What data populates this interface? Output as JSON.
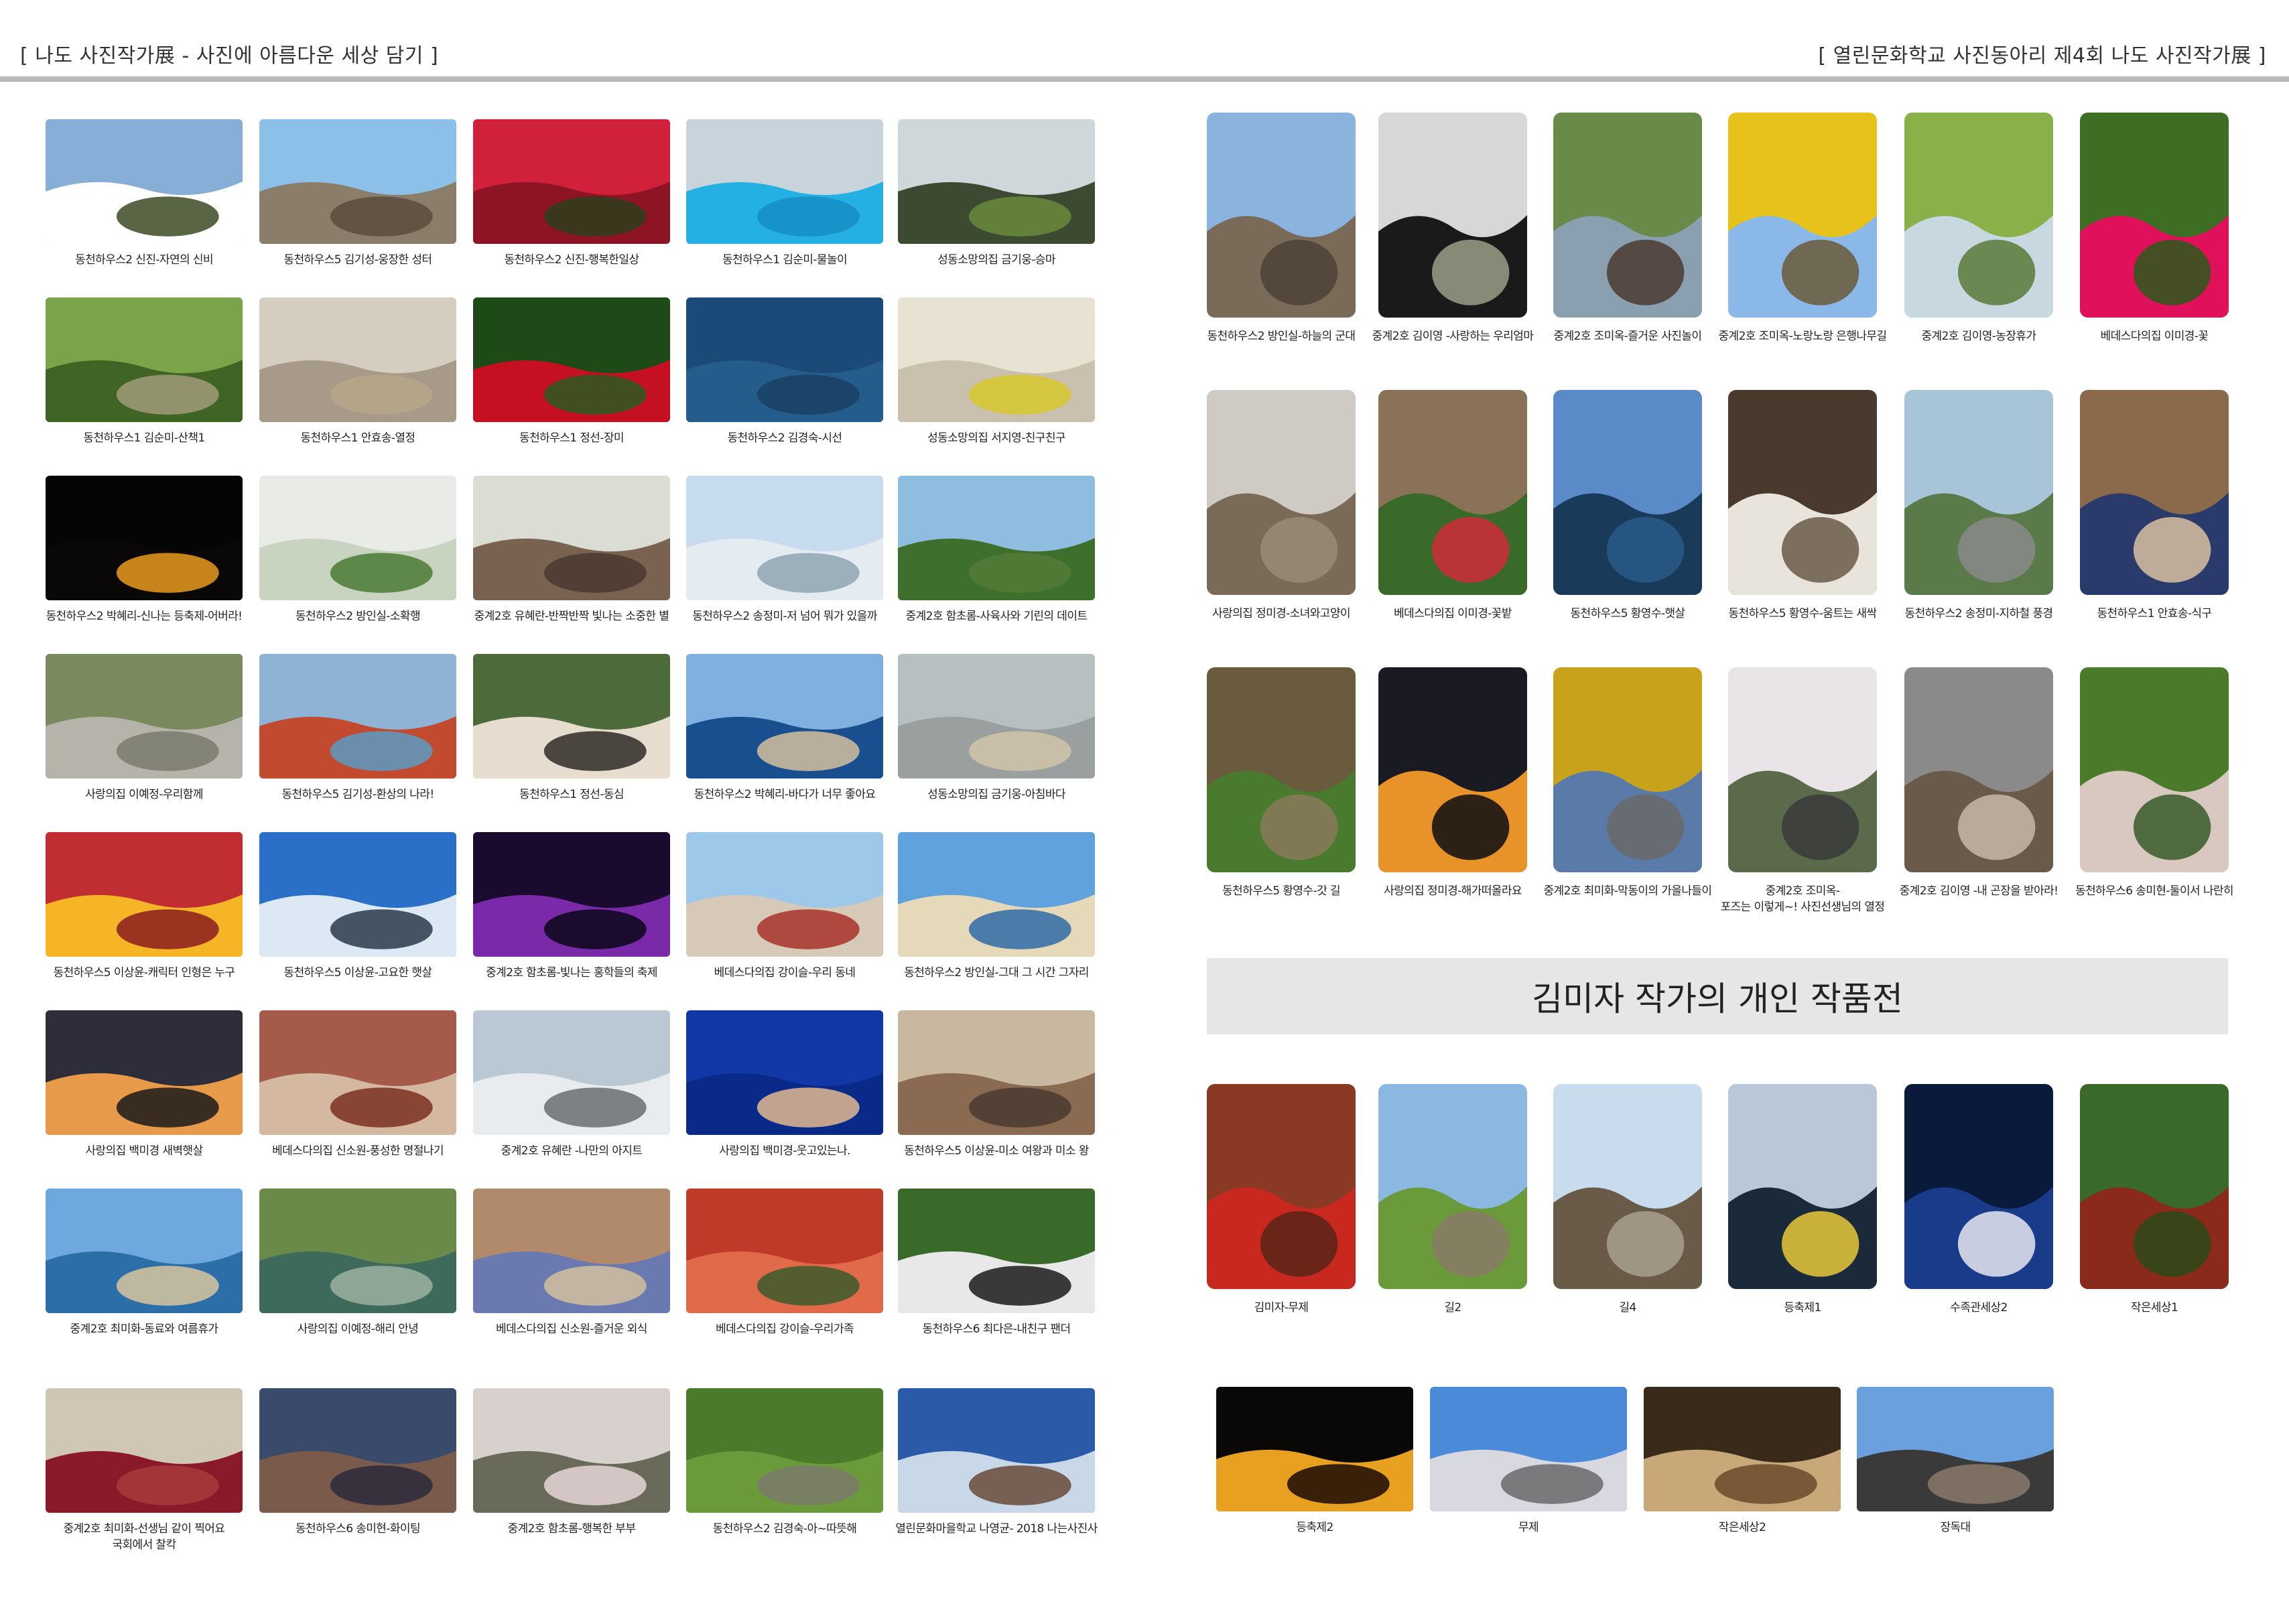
{
  "header": {
    "left_title": "[ 나도 사진작가展 - 사진에 아름다운 세상 담기 ]",
    "right_title": "[ 열린문화학교 사진동아리 제4회 나도 사진작가展 ]"
  },
  "section_banner": "김미자 작가의 개인 작품전",
  "colors": {
    "header_rule": "#b9b9b9",
    "banner_bg": "#e6e6e6"
  },
  "left_page": [
    {
      "caption": "동천하우스2 신진-자연의 신비",
      "colors": [
        "#86aed6",
        "#ffffff",
        "#3d4a26"
      ]
    },
    {
      "caption": "동천하우스5 김기성-웅장한 성터",
      "colors": [
        "#8cc0e8",
        "#8a7d6a",
        "#5b4b3c"
      ]
    },
    {
      "caption": "동천하우스2 신진-행복한일상",
      "colors": [
        "#d1203a",
        "#8c1424",
        "#2d3d1c"
      ]
    },
    {
      "caption": "동천하우스1 김순미-물놀이",
      "colors": [
        "#c8d4dc",
        "#24b0e2",
        "#168ec4"
      ]
    },
    {
      "caption": "성동소망의집 금기웅-승마",
      "colors": [
        "#cfd7db",
        "#3c4a32",
        "#6a8a3c"
      ]
    },
    {
      "caption": "동천하우스1 김순미-산책1",
      "colors": [
        "#7aa34a",
        "#3f6424",
        "#a19a7a"
      ]
    },
    {
      "caption": "동천하우스1 안효송-열정",
      "colors": [
        "#d5cdbf",
        "#a89a88",
        "#b6a78a"
      ]
    },
    {
      "caption": "동천하우스1 정선-장미",
      "colors": [
        "#1e4a18",
        "#c41020",
        "#2a5a1e"
      ]
    },
    {
      "caption": "동천하우스2 김경숙-시선",
      "colors": [
        "#1b4a78",
        "#245c8c",
        "#1a3f63"
      ]
    },
    {
      "caption": "성동소망의집 서지영-친구친구",
      "colors": [
        "#e8e2d2",
        "#c9c0ad",
        "#d8c82e"
      ]
    },
    {
      "caption": "동천하우스2 박혜리-신나는 등축제-어버라!",
      "colors": [
        "#050505",
        "#0a0806",
        "#e89a20"
      ]
    },
    {
      "caption": "동천하우스2 방인실-소확행",
      "colors": [
        "#e9ece6",
        "#c8d4c0",
        "#4a7a34"
      ]
    },
    {
      "caption": "중계2호 유혜란-반짝반짝 빛나는 소중한 별",
      "colors": [
        "#d9ddd4",
        "#7a6250",
        "#4a3a30"
      ]
    },
    {
      "caption": "동천하우스2 송정미-저 넘어 뭐가 있을까",
      "colors": [
        "#c7dcef",
        "#e5ecf1",
        "#8ea6b2"
      ]
    },
    {
      "caption": "중계2호 함초롬-사육사와 기린의 데이트",
      "colors": [
        "#8fbde0",
        "#3f6f2c",
        "#527b36"
      ]
    },
    {
      "caption": "사랑의집 이예정-우리함께",
      "colors": [
        "#7a8a5e",
        "#b5b3aa",
        "#7a7a70"
      ]
    },
    {
      "caption": "동천하우스5 김기성-환상의 나라!",
      "colors": [
        "#8fb3d4",
        "#c24a2e",
        "#5a9ac2"
      ]
    },
    {
      "caption": "동천하우스1 정선-동심",
      "colors": [
        "#4d6a3a",
        "#e7ddcf",
        "#2e2a26"
      ]
    },
    {
      "caption": "동천하우스2 박혜리-바다가 너무 좋아요",
      "colors": [
        "#7fb0e0",
        "#1a4f8f",
        "#d3c09e"
      ]
    },
    {
      "caption": "성동소망의집 금기웅-아침바다",
      "colors": [
        "#b8bfc1",
        "#9aa0a0",
        "#d1c3a8"
      ]
    },
    {
      "caption": "동천하우스5 이상윤-캐릭터 인형은 누구",
      "colors": [
        "#c02e32",
        "#f5b526",
        "#8a1c20"
      ]
    },
    {
      "caption": "동천하우스5 이상윤-고요한 햇살",
      "colors": [
        "#2a6fc8",
        "#dce8f4",
        "#2a3a4a"
      ]
    },
    {
      "caption": "중계2호 함초롬-빛나는 홍학들의 축제",
      "colors": [
        "#1a0a2e",
        "#7a2aa8",
        "#0b061a"
      ]
    },
    {
      "caption": "베데스다의집 강이슬-우리 동네",
      "colors": [
        "#9ec8ea",
        "#d7c9b7",
        "#a8332a"
      ]
    },
    {
      "caption": "동천하우스2 방인실-그대 그 시간 그자리",
      "colors": [
        "#5fa2de",
        "#e6d9ba",
        "#2e6aa6"
      ]
    },
    {
      "caption": "사랑의집 백미경 새벽햇살",
      "colors": [
        "#2e2d3a",
        "#e79a4a",
        "#1a1a1a"
      ]
    },
    {
      "caption": "베데스다의집 신소원-풍성한 명절나기",
      "colors": [
        "#a55a4a",
        "#d4b8a0",
        "#7a3020"
      ]
    },
    {
      "caption": "중계2호 유혜란 -나만의 아지트",
      "colors": [
        "#b9c8d3",
        "#e8ecef",
        "#6a6e72"
      ]
    },
    {
      "caption": "사랑의집 백미경-웃고있는나.",
      "colors": [
        "#1238a8",
        "#0a2a8a",
        "#e2b890"
      ]
    },
    {
      "caption": "동천하우스5 이상윤-미소 여왕과 미소 왕",
      "colors": [
        "#c8b8a0",
        "#8a6a50",
        "#4a3a30"
      ]
    },
    {
      "caption": "중계2호 최미화-동료와 여름휴가",
      "colors": [
        "#6ea8de",
        "#2c6ea8",
        "#d8c6a0"
      ]
    },
    {
      "caption": "사랑의집 이예정-해리 안녕",
      "colors": [
        "#6a8a4a",
        "#3d6a5a",
        "#9cb0a0"
      ]
    },
    {
      "caption": "베데스다의집 신소원-즐거운 외식",
      "colors": [
        "#b08a6a",
        "#6a7ab0",
        "#d4c0a0"
      ]
    },
    {
      "caption": "베데스다의집 강이슬-우리가족",
      "colors": [
        "#c03a2a",
        "#e06a4a",
        "#3a5a2a"
      ]
    },
    {
      "caption": "동천하우스6 최다은-내친구 팬더",
      "colors": [
        "#3a6a2a",
        "#e8e8e8",
        "#1a1a1a"
      ]
    },
    {
      "caption": "중계2호 최미화-선생님 같이 찍어요\n국회에서 찰칵",
      "colors": [
        "#cfc6b6",
        "#8a1a2a",
        "#a83a3a"
      ]
    },
    {
      "caption": "동천하우스6 송미현-화이팅",
      "colors": [
        "#3a4a6a",
        "#7a5a4a",
        "#2a2a3a"
      ]
    },
    {
      "caption": "중계2호 함초롬-행복한 부부",
      "colors": [
        "#d8d0cc",
        "#6a6a5a",
        "#e6d6d8"
      ]
    },
    {
      "caption": "동천하우스2 김경숙-아~따뜻해",
      "colors": [
        "#4a7a2a",
        "#6a9a3a",
        "#7a7a6a"
      ]
    },
    {
      "caption": "열린문화마을학교 나영균- 2018 나는사진사",
      "colors": [
        "#2a5aa8",
        "#c8d8e8",
        "#6a4a3a"
      ]
    }
  ],
  "right_page": [
    {
      "caption": "동천하우스2 방인실-하늘의 군대",
      "colors": [
        "#8ab4de",
        "#7a6a58",
        "#4e4238"
      ]
    },
    {
      "caption": "중계2호 김이영 -사랑하는 우리엄마",
      "colors": [
        "#d6d8d6",
        "#1a1a1a",
        "#9aa08a"
      ]
    },
    {
      "caption": "중계2호 조미옥-즐거운 사진놀이",
      "colors": [
        "#6a8a4a",
        "#8aa0b0",
        "#4a3a30"
      ]
    },
    {
      "caption": "중계2호 조미옥-노랑노랑 은행나무길",
      "colors": [
        "#e6c21a",
        "#8ab8e8",
        "#6a5a3a"
      ]
    },
    {
      "caption": "중계2호 김이영-농장휴가",
      "colors": [
        "#8ab04a",
        "#c8d8e0",
        "#5a7a3a"
      ]
    },
    {
      "caption": "베데스다의집 이미경-꽃",
      "colors": [
        "#3e6e24",
        "#e0105a",
        "#2a5a1a"
      ]
    },
    {
      "caption": "사랑의집 정미경-소녀와고양이",
      "colors": [
        "#cfcac4",
        "#7a6a58",
        "#9a8a78"
      ]
    },
    {
      "caption": "베데스다의집 이미경-꽃밭",
      "colors": [
        "#8a7258",
        "#3a6a2a",
        "#d02a3a"
      ]
    },
    {
      "caption": "동천하우스5 황영수-햇살",
      "colors": [
        "#5a8ac8",
        "#1a3a5a",
        "#2a5a8a"
      ]
    },
    {
      "caption": "동천하우스5 황영수-움트는 새싹",
      "colors": [
        "#4a3a2e",
        "#e8e4dc",
        "#6a5a48"
      ]
    },
    {
      "caption": "동천하우스2 송정미-지하철 풍경",
      "colors": [
        "#a8c4d8",
        "#5a7a4a",
        "#8a8a88"
      ]
    },
    {
      "caption": "동천하우스1 안효송-식구",
      "colors": [
        "#8a6a4a",
        "#2a3a6a",
        "#d8c0a0"
      ]
    },
    {
      "caption": "동천하우스5 황영수-갓 길",
      "colors": [
        "#6a5a3e",
        "#4a7a2e",
        "#8a7a5a"
      ]
    },
    {
      "caption": "사랑의집 정미경-해가떠올라요",
      "colors": [
        "#1a1a22",
        "#e8922a",
        "#0c0c10"
      ]
    },
    {
      "caption": "중계2호 최미화-막동이의 가을나들이",
      "colors": [
        "#c8a21a",
        "#5a7aa8",
        "#6a6a6a"
      ]
    },
    {
      "caption": "중계2호 조미옥-\n포즈는 이렇게~! 사진선생님의 열정",
      "colors": [
        "#e8e4e8",
        "#5a6a4a",
        "#3a3a3a"
      ]
    },
    {
      "caption": "중계2호 김이영 -내 곤장을 받아라!",
      "colors": [
        "#8a8a8a",
        "#6a5a4a",
        "#c8b8a8"
      ]
    },
    {
      "caption": "동천하우스6 송미현-둘이서 나란히",
      "colors": [
        "#4a7a2a",
        "#d8c8c0",
        "#3a5a2a"
      ]
    }
  ],
  "kim_gallery": [
    {
      "caption": "김미자-무제",
      "colors": [
        "#8a3a24",
        "#c8281e",
        "#5a2418"
      ]
    },
    {
      "caption": "길2",
      "colors": [
        "#8ab8e0",
        "#6a9a3a",
        "#8a7a6a"
      ]
    },
    {
      "caption": "길4",
      "colors": [
        "#c8dcee",
        "#6a5a48",
        "#a8a090"
      ]
    },
    {
      "caption": "등축제1",
      "colors": [
        "#b8c8d8",
        "#1a2a3a",
        "#e8c83a"
      ]
    },
    {
      "caption": "수족관세상2",
      "colors": [
        "#0a1a3a",
        "#1a3a8a",
        "#e8e8f0"
      ]
    },
    {
      "caption": "작은세상1",
      "colors": [
        "#3a6a2a",
        "#8a2a1a",
        "#2a4a1a"
      ]
    },
    {
      "caption": "등축제2",
      "colors": [
        "#0a0806",
        "#e8a020",
        "#1a0a06"
      ]
    },
    {
      "caption": "무제",
      "colors": [
        "#4a8ad8",
        "#d8d8e0",
        "#6a6a6a"
      ]
    },
    {
      "caption": "작은세상2",
      "colors": [
        "#3a2a1a",
        "#c8a878",
        "#6a4a2a"
      ]
    },
    {
      "caption": "장독대",
      "colors": [
        "#6aa0de",
        "#3a3a3a",
        "#8a7a6a"
      ]
    }
  ]
}
